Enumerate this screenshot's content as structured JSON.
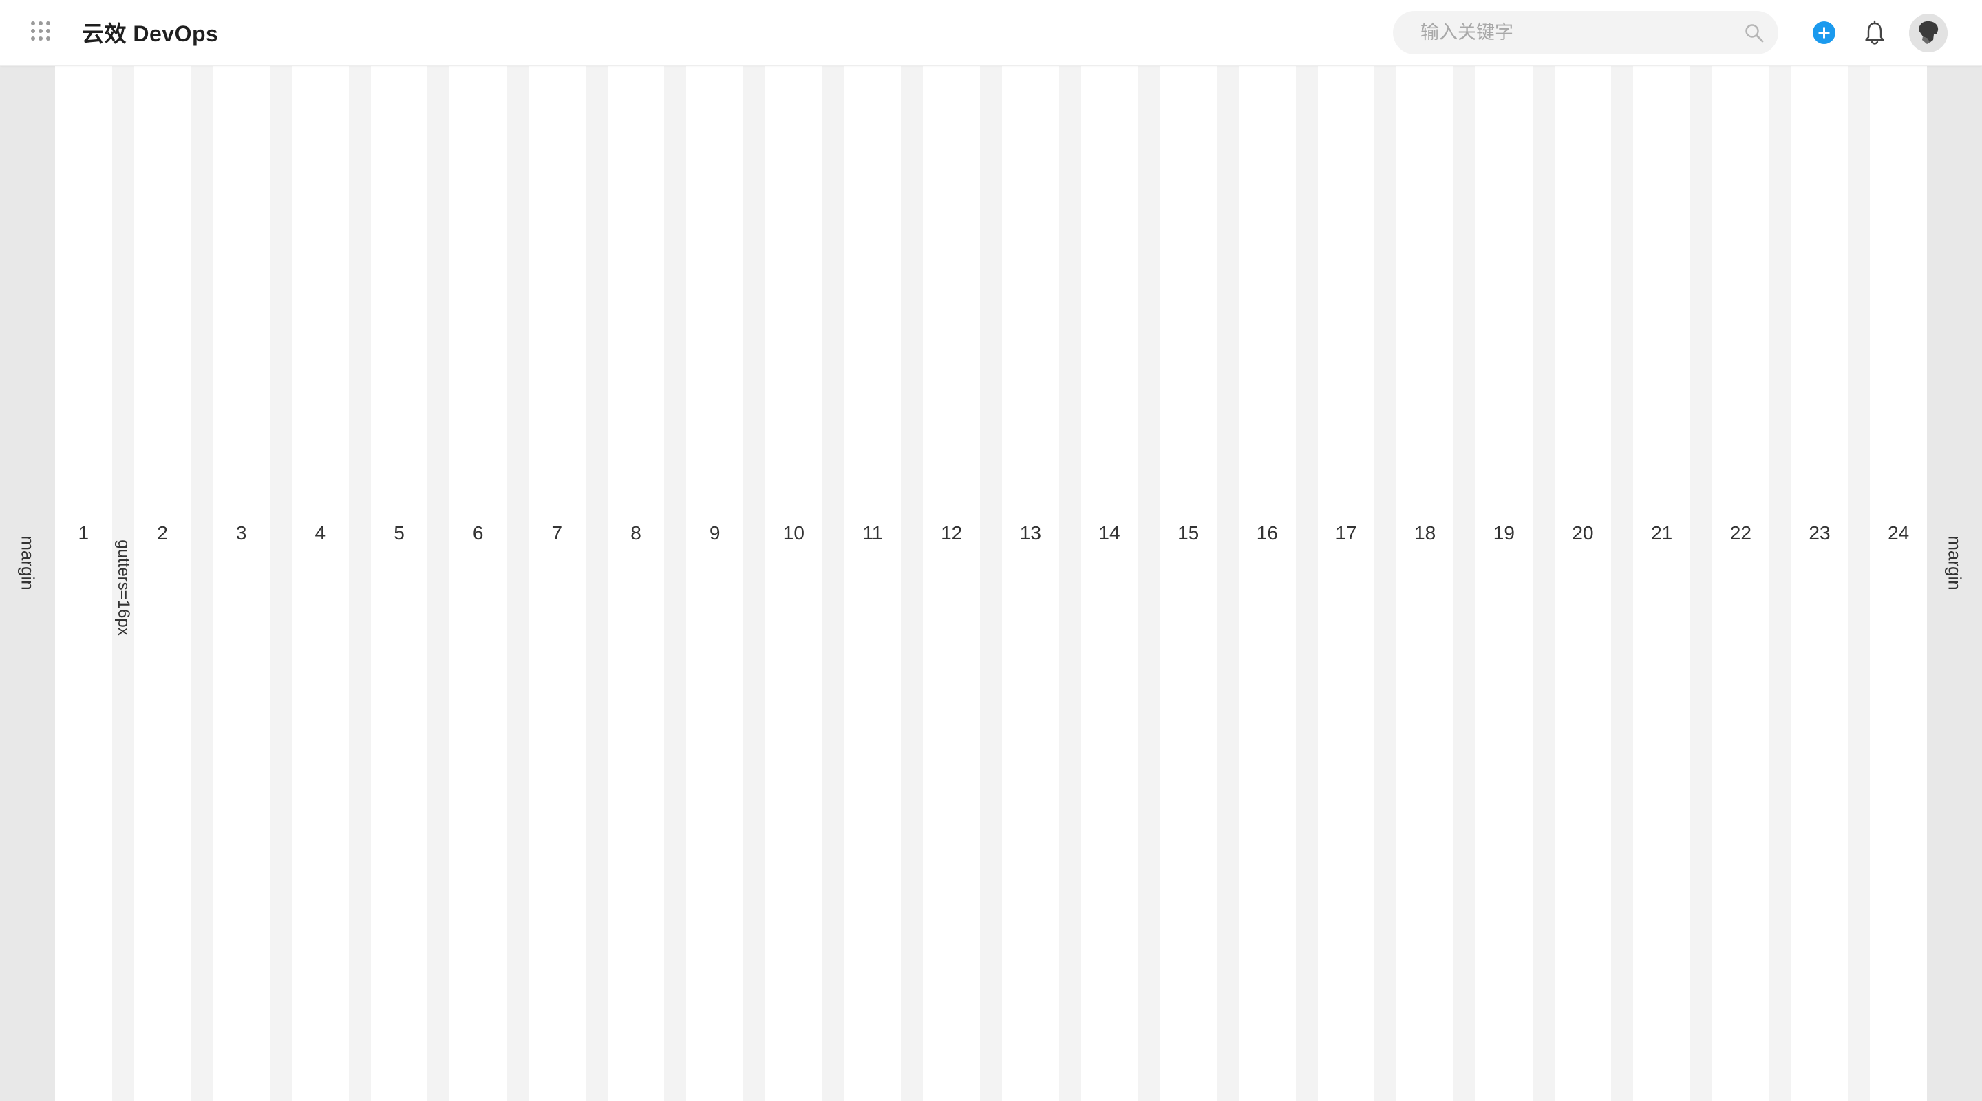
{
  "header": {
    "brand": "云效 DevOps",
    "search_placeholder": "输入关键字",
    "search_value": ""
  },
  "icons": {
    "apps": "grid-apps-icon",
    "search": "search-icon",
    "add": "plus-circle-icon",
    "notifications": "bell-icon",
    "avatar": "user-avatar"
  },
  "colors": {
    "accent": "#1b9aee",
    "margin_bg": "#e8e8e8",
    "gutter_bg": "#f3f3f3",
    "column_bg": "#ffffff"
  },
  "grid": {
    "margin_left_label": "margin",
    "margin_right_label": "margin",
    "gutter_label": "gutters=16px",
    "columns": [
      "1",
      "2",
      "3",
      "4",
      "5",
      "6",
      "7",
      "8",
      "9",
      "10",
      "11",
      "12",
      "13",
      "14",
      "15",
      "16",
      "17",
      "18",
      "19",
      "20",
      "21",
      "22",
      "23",
      "24"
    ]
  }
}
